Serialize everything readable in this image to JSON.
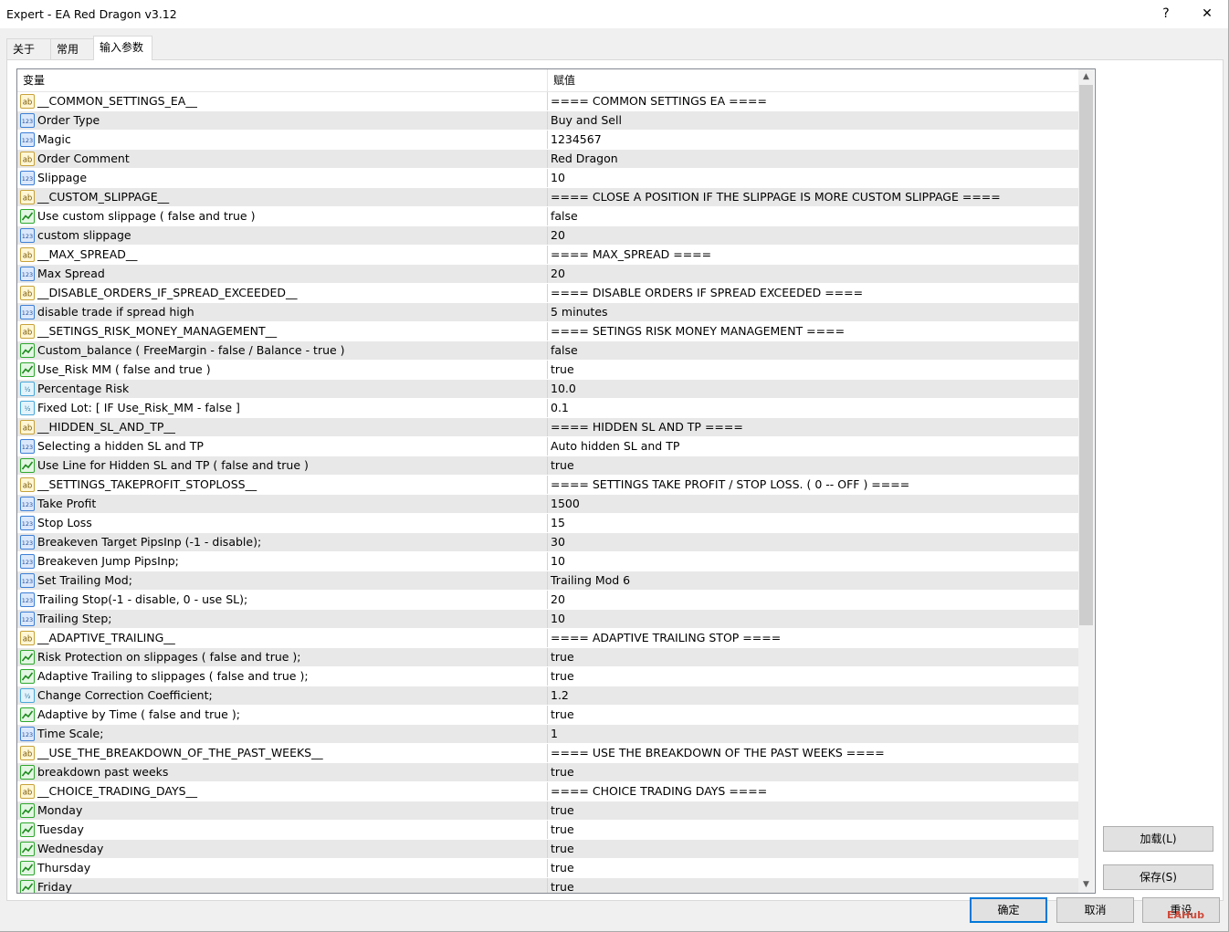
{
  "window": {
    "title": "Expert - EA Red Dragon v3.12",
    "help_label": "?",
    "close_label": "✕"
  },
  "tabs": [
    {
      "label": "关于"
    },
    {
      "label": "常用"
    },
    {
      "label": "输入参数"
    }
  ],
  "grid": {
    "col_variable": "变量",
    "col_value": "赋值"
  },
  "rows": [
    {
      "icon": "ab",
      "name": "__COMMON_SETTINGS_EA__",
      "value": "==== COMMON SETTINGS EA ===="
    },
    {
      "icon": "123",
      "name": "Order Type",
      "value": "Buy and Sell"
    },
    {
      "icon": "123",
      "name": "Magic",
      "value": "1234567"
    },
    {
      "icon": "ab",
      "name": "Order Comment",
      "value": "Red Dragon"
    },
    {
      "icon": "123",
      "name": "Slippage",
      "value": "10"
    },
    {
      "icon": "ab",
      "name": "__CUSTOM_SLIPPAGE__",
      "value": "==== CLOSE A POSITION IF THE SLIPPAGE IS MORE CUSTOM SLIPPAGE ===="
    },
    {
      "icon": "bool",
      "name": "Use custom slippage ( false and true )",
      "value": "false"
    },
    {
      "icon": "123",
      "name": "custom slippage",
      "value": "20"
    },
    {
      "icon": "ab",
      "name": "__MAX_SPREAD__",
      "value": "==== MAX_SPREAD ===="
    },
    {
      "icon": "123",
      "name": "Max Spread",
      "value": "20"
    },
    {
      "icon": "ab",
      "name": "__DISABLE_ORDERS_IF_SPREAD_EXCEEDED__",
      "value": "==== DISABLE ORDERS IF SPREAD EXCEEDED ===="
    },
    {
      "icon": "123",
      "name": "disable trade if spread high",
      "value": "5 minutes"
    },
    {
      "icon": "ab",
      "name": "__SETINGS_RISK_MONEY_MANAGEMENT__",
      "value": "==== SETINGS RISK MONEY MANAGEMENT ===="
    },
    {
      "icon": "bool",
      "name": "Custom_balance ( FreeMargin - false / Balance - true )",
      "value": "false"
    },
    {
      "icon": "bool",
      "name": "Use_Risk MM ( false and true )",
      "value": "true"
    },
    {
      "icon": "half",
      "name": "Percentage Risk",
      "value": "10.0"
    },
    {
      "icon": "half",
      "name": "Fixed Lot: [ IF  Use_Risk_MM - false ]",
      "value": "0.1"
    },
    {
      "icon": "ab",
      "name": "__HIDDEN_SL_AND_TP__",
      "value": "==== HIDDEN SL AND TP ===="
    },
    {
      "icon": "123",
      "name": "Selecting a hidden SL and TP",
      "value": "Auto hidden SL and TP"
    },
    {
      "icon": "bool",
      "name": "Use Line for Hidden SL and TP ( false and true )",
      "value": "true"
    },
    {
      "icon": "ab",
      "name": "__SETTINGS_TAKEPROFIT_STOPLOSS__",
      "value": "==== SETTINGS TAKE PROFIT / STOP LOSS. ( 0 -- OFF ) ===="
    },
    {
      "icon": "123",
      "name": "Take Profit",
      "value": "1500"
    },
    {
      "icon": "123",
      "name": "Stop Loss",
      "value": "15"
    },
    {
      "icon": "123",
      "name": "Breakeven Target PipsInp (-1 - disable);",
      "value": "30"
    },
    {
      "icon": "123",
      "name": "Breakeven Jump PipsInp;",
      "value": "10"
    },
    {
      "icon": "123",
      "name": "Set Trailing Mod;",
      "value": "Trailing Mod 6"
    },
    {
      "icon": "123",
      "name": "Trailing Stop(-1 - disable, 0 - use SL);",
      "value": "20"
    },
    {
      "icon": "123",
      "name": "Trailing Step;",
      "value": "10"
    },
    {
      "icon": "ab",
      "name": "__ADAPTIVE_TRAILING__",
      "value": "==== ADAPTIVE TRAILING STOP ===="
    },
    {
      "icon": "bool",
      "name": "Risk Protection on slippages ( false and true );",
      "value": "true"
    },
    {
      "icon": "bool",
      "name": "Adaptive Trailing to slippages ( false and true );",
      "value": "true"
    },
    {
      "icon": "half",
      "name": "Change Correction Coefficient;",
      "value": "1.2"
    },
    {
      "icon": "bool",
      "name": "Adaptive by Time ( false and true );",
      "value": "true"
    },
    {
      "icon": "123",
      "name": "Time Scale;",
      "value": "1"
    },
    {
      "icon": "ab",
      "name": "__USE_THE_BREAKDOWN_OF_THE_PAST_WEEKS__",
      "value": "==== USE THE BREAKDOWN OF THE PAST WEEKS ===="
    },
    {
      "icon": "bool",
      "name": "breakdown past weeks",
      "value": "true"
    },
    {
      "icon": "ab",
      "name": "__CHOICE_TRADING_DAYS__",
      "value": "==== CHOICE TRADING DAYS ===="
    },
    {
      "icon": "bool",
      "name": "Monday",
      "value": "true"
    },
    {
      "icon": "bool",
      "name": "Tuesday",
      "value": "true"
    },
    {
      "icon": "bool",
      "name": "Wednesday",
      "value": "true"
    },
    {
      "icon": "bool",
      "name": "Thursday",
      "value": "true"
    },
    {
      "icon": "bool",
      "name": "Friday",
      "value": "true"
    }
  ],
  "side_buttons": {
    "load": "加载(L)",
    "save": "保存(S)"
  },
  "bottom_buttons": {
    "ok": "确定",
    "cancel": "取消",
    "reset": "重设"
  },
  "watermark": "EAHub",
  "colors": {
    "accent": "#0078d7",
    "icon_ab": "#f5c542",
    "icon_123": "#3d7fd6",
    "icon_bool": "#2ea82e",
    "icon_half": "#49a7d9"
  }
}
